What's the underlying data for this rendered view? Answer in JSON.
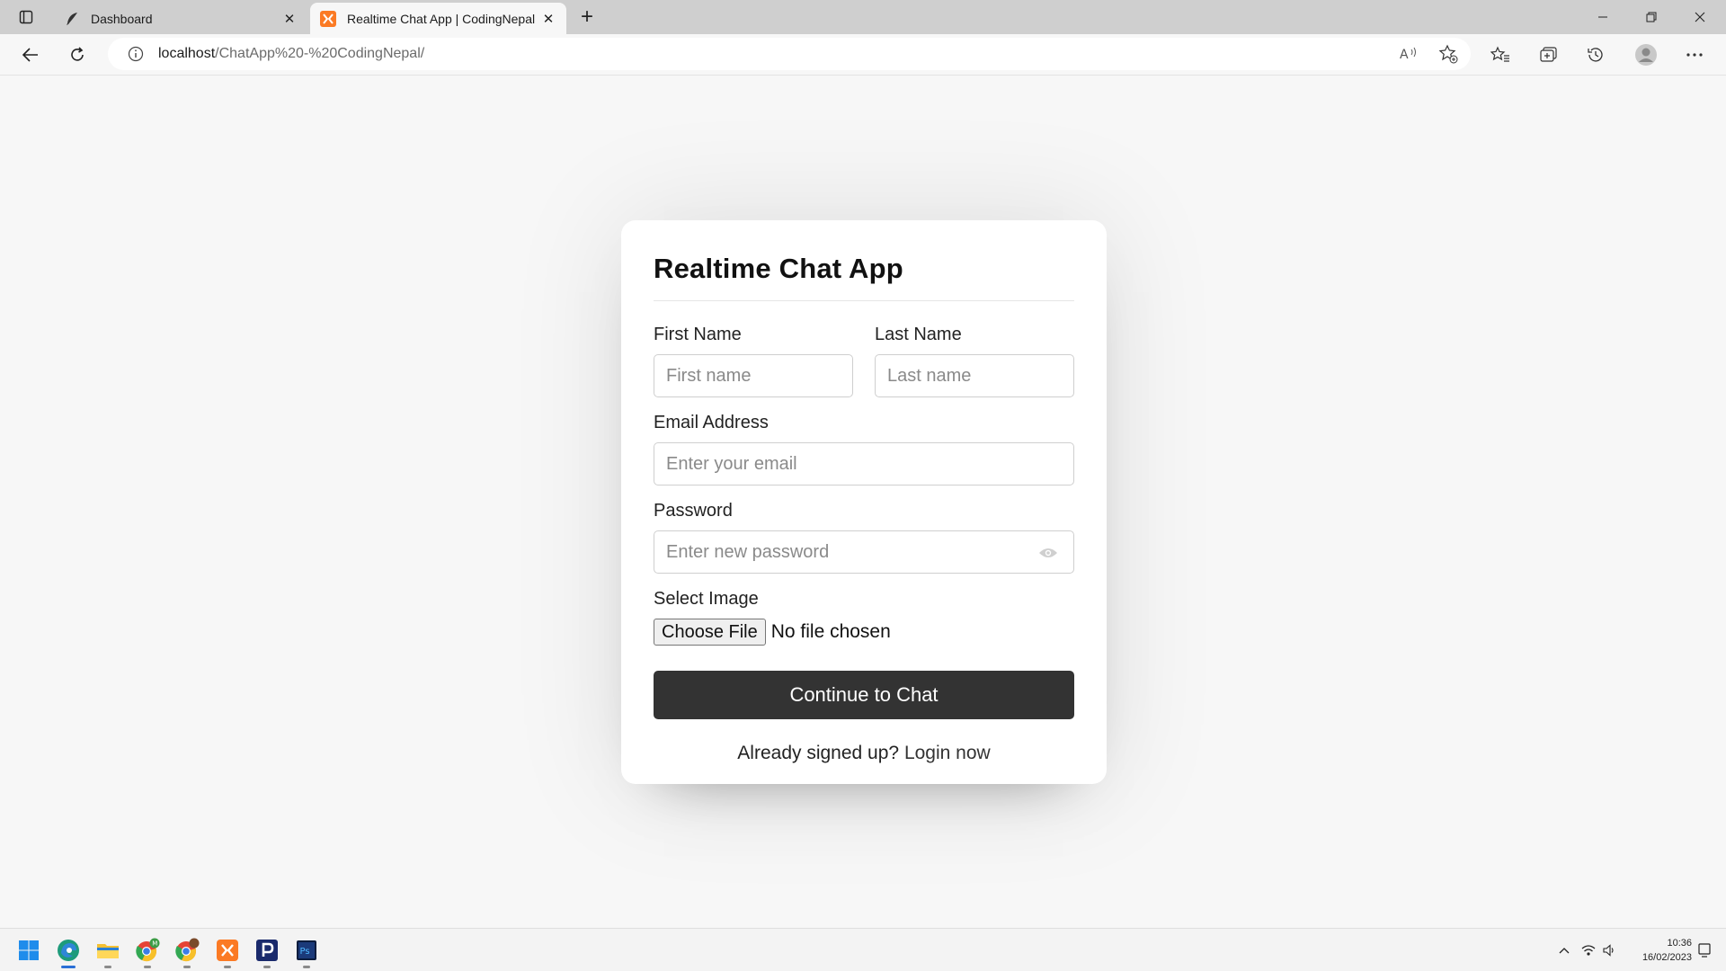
{
  "browser": {
    "tabs": [
      {
        "title": "Dashboard",
        "active": false,
        "favicon": "feather-icon"
      },
      {
        "title": "Realtime Chat App | CodingNepal",
        "active": true,
        "favicon": "xampp-icon"
      }
    ],
    "url": {
      "host": "localhost",
      "path": "/ChatApp%20-%20CodingNepal/"
    }
  },
  "form": {
    "title": "Realtime Chat App",
    "first_name": {
      "label": "First Name",
      "placeholder": "First name"
    },
    "last_name": {
      "label": "Last Name",
      "placeholder": "Last name"
    },
    "email": {
      "label": "Email Address",
      "placeholder": "Enter your email"
    },
    "password": {
      "label": "Password",
      "placeholder": "Enter new password"
    },
    "image": {
      "label": "Select Image",
      "button": "Choose File",
      "status": "No file chosen"
    },
    "submit": "Continue to Chat",
    "signin_prompt": "Already signed up?",
    "signin_link": "Login now"
  },
  "taskbar": {
    "apps": [
      "windows-start",
      "edge",
      "file-explorer",
      "chrome-profile-m",
      "chrome-profile-2",
      "xampp",
      "pandora-p",
      "photoshop"
    ],
    "time": "10:36",
    "date": "16/02/2023"
  },
  "colors": {
    "submit_bg": "#333333",
    "page_bg": "#f7f7f7",
    "xampp": "#fb7a24",
    "edge_accent": "#2a6fd6"
  }
}
